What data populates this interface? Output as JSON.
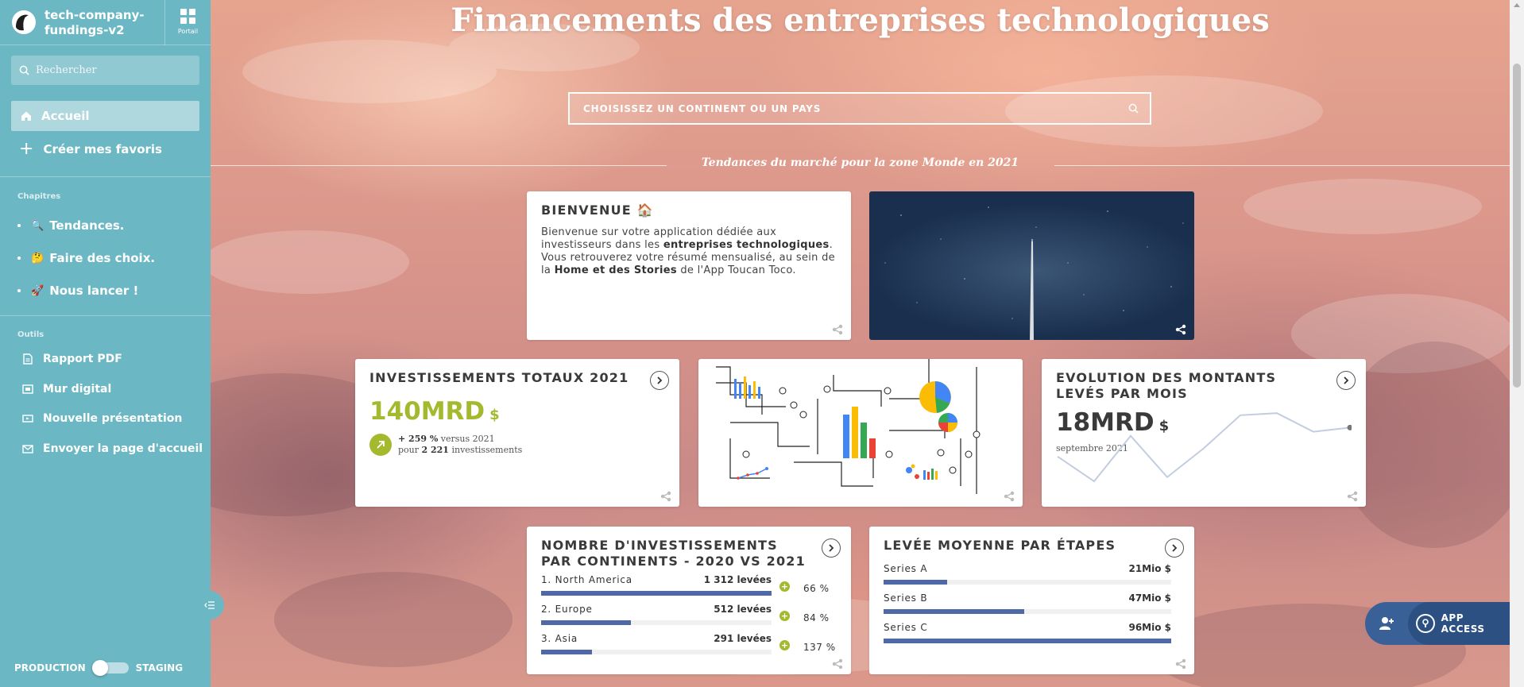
{
  "app": {
    "name": "tech-company-fundings-v2",
    "portal_label": "Portail"
  },
  "sidebar": {
    "search_placeholder": "Rechercher",
    "home_label": "Accueil",
    "favorites_label": "Créer mes favoris",
    "chapters_title": "Chapitres",
    "chapters": [
      {
        "emoji": "🔍",
        "label": "Tendances."
      },
      {
        "emoji": "🤔",
        "label": "Faire des choix."
      },
      {
        "emoji": "🚀",
        "label": "Nous lancer !"
      }
    ],
    "tools_title": "Outils",
    "tools": [
      {
        "icon": "pdf-report-icon",
        "label": "Rapport PDF"
      },
      {
        "icon": "wall-icon",
        "label": "Mur digital"
      },
      {
        "icon": "presentation-icon",
        "label": "Nouvelle présentation"
      },
      {
        "icon": "send-icon",
        "label": "Envoyer la page d'accueil"
      }
    ],
    "env_left": "PRODUCTION",
    "env_right": "STAGING"
  },
  "main": {
    "title": "Financements des entreprises technologiques",
    "search_placeholder": "CHOISISSEZ UN CONTINENT OU UN PAYS",
    "trend_label": "Tendances du marché pour la zone Monde en 2021"
  },
  "welcome": {
    "title": "BIENVENUE 🏠",
    "t1": "Bienvenue sur votre application dédiée aux investisseurs dans les ",
    "b1": "entreprises technologiques",
    "t2": ". Vous retrouverez votre résumé mensualisé, au sein de la ",
    "b2": "Home et des Stories",
    "t3": " de l'App Toucan Toco."
  },
  "total": {
    "title": "INVESTISSEMENTS TOTAUX 2021",
    "value": "140MRD",
    "unit": "$",
    "variation": "+ 259 %",
    "versus": "versus 2021",
    "count_prefix": "pour",
    "count": "2 221",
    "count_suffix": "investissements",
    "accent_color": "#a4b92e"
  },
  "evolution": {
    "title": "EVOLUTION DES MONTANTS LEVÉS PAR MOIS",
    "value": "18MRD",
    "unit": "$",
    "period": "septembre 2021",
    "sparkline": [
      62,
      50,
      72,
      52,
      66,
      82,
      83,
      74,
      76
    ]
  },
  "continents": {
    "title": "NOMBRE D'INVESTISSEMENTS PAR CONTINENTS - 2020 VS 2021",
    "rows": [
      {
        "label": "1. North America",
        "value": "1 312 levées",
        "share": 1.0,
        "pct": "66 %"
      },
      {
        "label": "2. Europe",
        "value": "512 levées",
        "share": 0.39,
        "pct": "84 %"
      },
      {
        "label": "3. Asia",
        "value": "291 levées",
        "share": 0.22,
        "pct": "137 %"
      }
    ]
  },
  "stages": {
    "title": "LEVÉE MOYENNE PAR ÉTAPES",
    "rows": [
      {
        "label": "Series A",
        "value": "21Mio $",
        "share": 0.22
      },
      {
        "label": "Series B",
        "value": "47Mio $",
        "share": 0.49
      },
      {
        "label": "Series C",
        "value": "96Mio $",
        "share": 1.0
      }
    ]
  },
  "app_access_label": "APP ACCESS",
  "colors": {
    "sidebar": "#6cb7c4",
    "bar": "#4f68a6",
    "accent": "#a4b92e",
    "app_access": "#3a6197"
  }
}
